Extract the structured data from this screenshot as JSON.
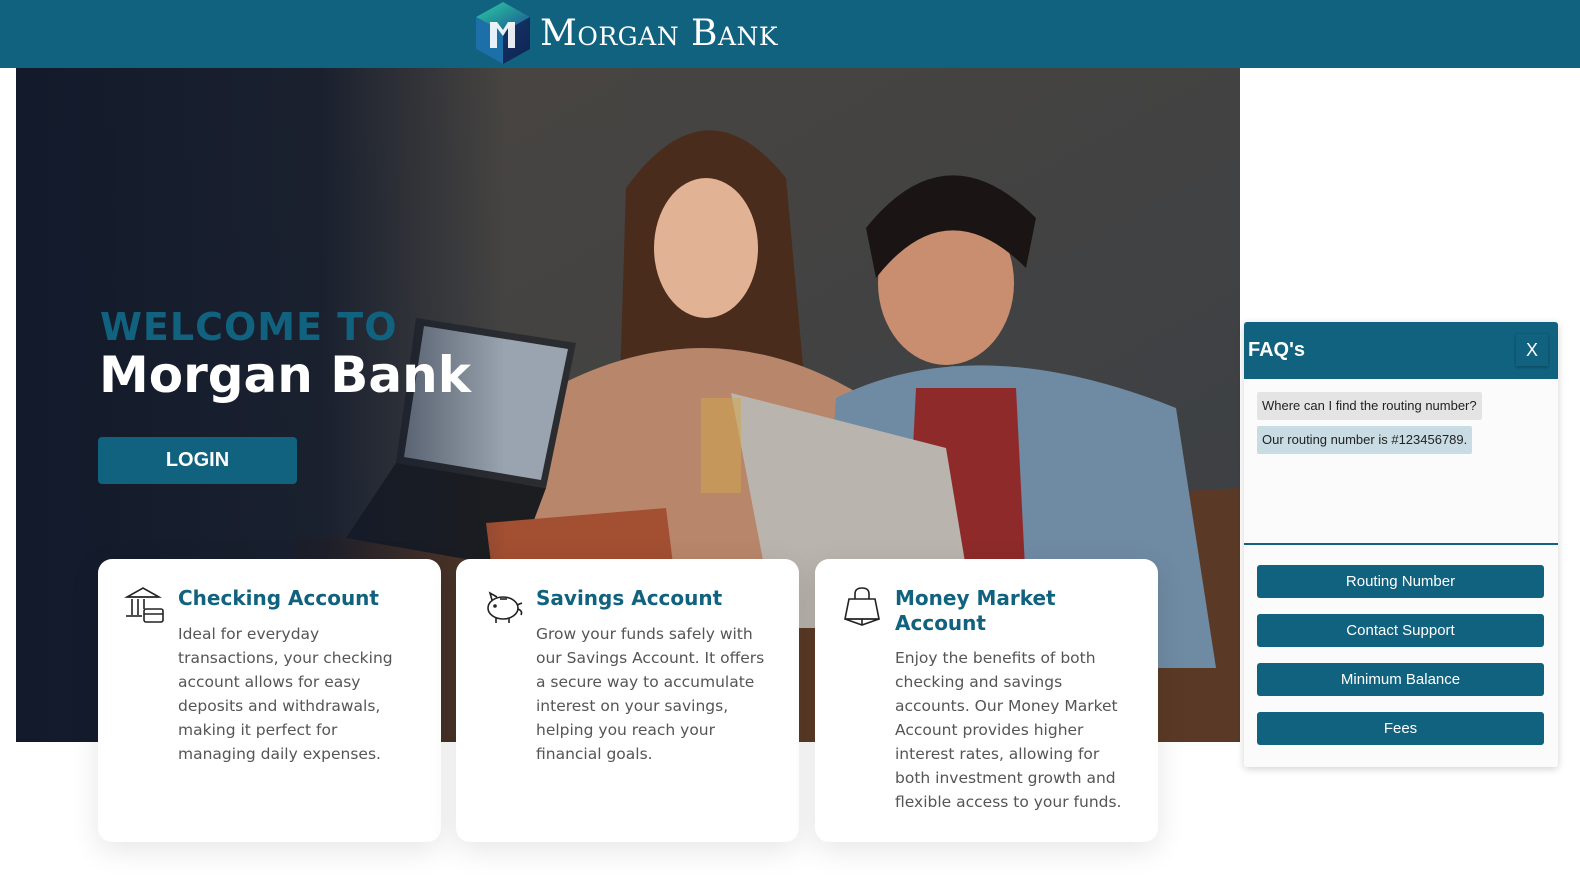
{
  "header": {
    "brand_name": "Morgan Bank",
    "logo_icon": "cube-logo-icon"
  },
  "hero": {
    "welcome": "WELCOME TO",
    "title": "Morgan Bank",
    "login_label": "LOGIN"
  },
  "cards": [
    {
      "icon": "bank-card-icon",
      "title": "Checking Account",
      "description": "Ideal for everyday transactions, your checking account allows for easy deposits and withdrawals, making it perfect for managing daily expenses."
    },
    {
      "icon": "piggy-bank-icon",
      "title": "Savings Account",
      "description": "Grow your funds safely with our Savings Account. It offers a secure way to accumulate interest on your savings, helping you reach your financial goals."
    },
    {
      "icon": "shopping-bag-icon",
      "title": "Money Market Account",
      "description": "Enjoy the benefits of both checking and savings accounts. Our Money Market Account provides higher interest rates, allowing for both investment growth and flexible access to your funds."
    }
  ],
  "faq": {
    "title": "FAQ's",
    "close_label": "X",
    "messages": [
      {
        "role": "user",
        "text": "Where can I find the routing number?"
      },
      {
        "role": "bot",
        "text": "Our routing number is #123456789."
      }
    ],
    "buttons": [
      "Routing Number",
      "Contact Support",
      "Minimum Balance",
      "Fees"
    ]
  },
  "colors": {
    "brand": "#10627f",
    "card_text": "#555555",
    "bot_bubble": "#c9dce3",
    "user_bubble": "#e4e4e4"
  }
}
